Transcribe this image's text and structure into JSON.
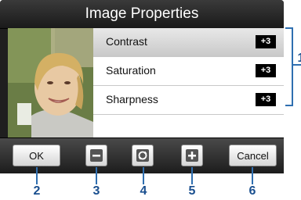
{
  "window": {
    "title": "Image Properties"
  },
  "properties": [
    {
      "label": "Contrast",
      "value": "+3",
      "selected": true
    },
    {
      "label": "Saturation",
      "value": "+3",
      "selected": false
    },
    {
      "label": "Sharpness",
      "value": "+3",
      "selected": false
    }
  ],
  "toolbar": {
    "ok_label": "OK",
    "cancel_label": "Cancel",
    "decrease_icon": "minus-icon",
    "reset_icon": "refresh-icon",
    "increase_icon": "plus-icon"
  },
  "callouts": [
    "1",
    "2",
    "3",
    "4",
    "5",
    "6"
  ],
  "colors": {
    "accent": "#2f6fb0",
    "callout_text": "#1a4f8f",
    "selected_row": "#d4d4d4"
  }
}
